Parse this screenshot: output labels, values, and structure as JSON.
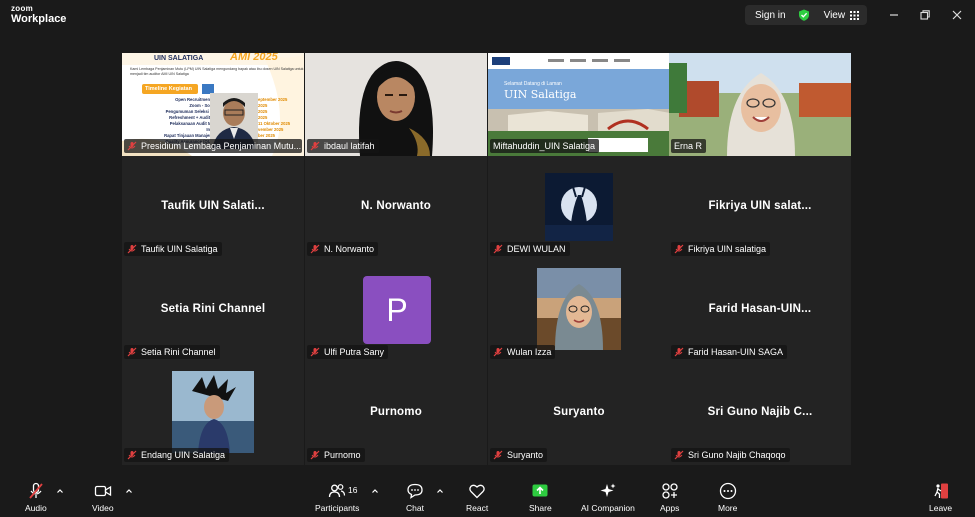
{
  "app": {
    "logo_line1": "zoom",
    "logo_line2": "Workplace"
  },
  "titlebar": {
    "signin": "Sign in",
    "view": "View"
  },
  "screenshare": {
    "title": "UIN SALATIGA",
    "year_word": "AMI 2025",
    "intro": "Kami Lembaga Penjaminan Mutu (LPM) UIN Salatiga mengundang bapak atau ibu dosen UIN Salatiga untuk menjadi tim auditor AMI UIN Salatiga",
    "timeline_label": "Timeline Kegiatan",
    "items": [
      "Open Recruitment Au",
      "Zoom - Sosiali",
      "Pengumuman Seleksi Aud",
      "Refreshment + Auditor d",
      "Pelaksanaan Audit Mutu Intern",
      "Rapat Tinjauan Manajemen",
      "Quality Assurance (QUAS)"
    ],
    "dates": [
      "eptember 2025",
      "2025",
      "2025",
      "2025",
      "11 Oktober 2025",
      "vember 2025",
      "ber 2025"
    ]
  },
  "website": {
    "banner_small": "Selamat Datang di Laman",
    "banner_title": "UIN Salatiga"
  },
  "participants": [
    {
      "tag": "Presidium Lembaga Penjaminan Mutu...",
      "center": ""
    },
    {
      "tag": "ibdaul latifah",
      "center": ""
    },
    {
      "tag": "Miftahuddin_UIN Salatiga",
      "center": ""
    },
    {
      "tag": "Erna R",
      "center": ""
    },
    {
      "tag": "Taufik UIN Salatiga",
      "center": "Taufik UIN Salati..."
    },
    {
      "tag": "N. Norwanto",
      "center": "N. Norwanto"
    },
    {
      "tag": "DEWI WULAN",
      "center": ""
    },
    {
      "tag": "Fikriya UIN salatiga",
      "center": "Fikriya UIN salat..."
    },
    {
      "tag": "Setia Rini Channel",
      "center": "Setia Rini Channel"
    },
    {
      "tag": "Ulfi Putra Sany",
      "center": "",
      "initial": "P"
    },
    {
      "tag": "Wulan Izza",
      "center": ""
    },
    {
      "tag": "Farid Hasan-UIN SAGA",
      "center": "Farid Hasan-UIN..."
    },
    {
      "tag": "Endang UIN Salatiga",
      "center": ""
    },
    {
      "tag": "Purnomo",
      "center": "Purnomo"
    },
    {
      "tag": "Suryanto",
      "center": "Suryanto"
    },
    {
      "tag": "Sri Guno Najib Chaqoqo",
      "center": "Sri Guno Najib C..."
    }
  ],
  "toolbar": {
    "audio": "Audio",
    "video": "Video",
    "participants": "Participants",
    "participant_count": "16",
    "chat": "Chat",
    "react": "React",
    "share": "Share",
    "ai": "AI Companion",
    "apps": "Apps",
    "more": "More",
    "leave": "Leave"
  },
  "colors": {
    "active_border": "#2ecc40",
    "share_green": "#2ecc40",
    "avatar_purple": "#8a4fc0",
    "muted_red": "#e04040"
  }
}
